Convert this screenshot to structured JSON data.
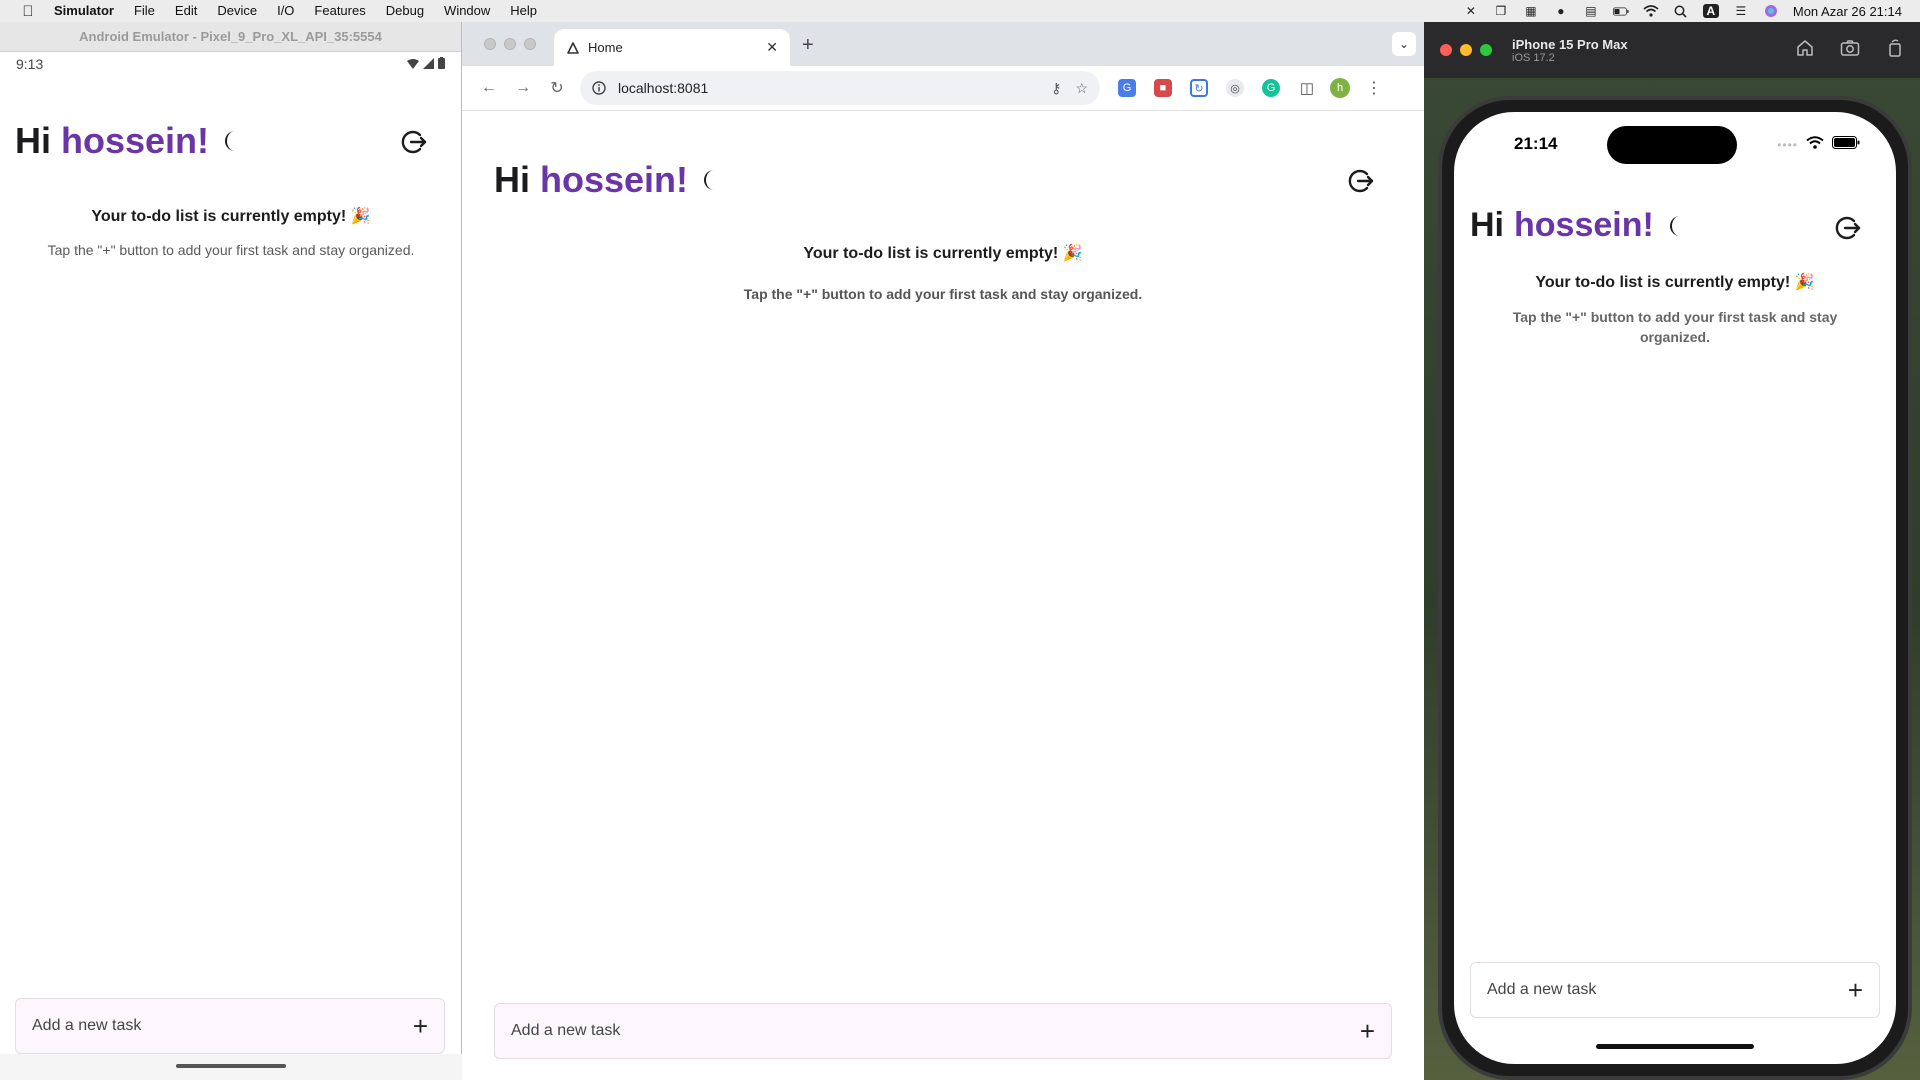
{
  "menubar": {
    "app_name": "Simulator",
    "items": [
      "File",
      "Edit",
      "Device",
      "I/O",
      "Features",
      "Debug",
      "Window",
      "Help"
    ],
    "datetime": "Mon Azar 26  21:14",
    "status_icons": [
      "tools-icon",
      "window-icon",
      "stack-icon",
      "grammarly-icon",
      "keyboard-icon",
      "battery-icon",
      "wifi-icon",
      "search-icon",
      "input-source-icon",
      "control-center-icon",
      "siri-icon"
    ]
  },
  "android": {
    "window_title": "Android Emulator - Pixel_9_Pro_XL_API_35:5554",
    "status_time": "9:13"
  },
  "browser": {
    "tab_title": "Home",
    "url": "localhost:8081",
    "avatar_letter": "h"
  },
  "ios": {
    "device_name": "iPhone 15 Pro Max",
    "os_version": "iOS 17.2",
    "status_time": "21:14"
  },
  "app": {
    "greeting_hi": "Hi",
    "greeting_name": "hossein!",
    "empty_title": "Your to-do list is currently empty! 🎉",
    "empty_subtitle": "Tap the \"+\" button to add your first task and stay organized.",
    "add_placeholder": "Add a new task",
    "add_button": "+"
  },
  "colors": {
    "accent_name": "#6a35a6",
    "add_bar_bg": "#fdf7fd"
  }
}
